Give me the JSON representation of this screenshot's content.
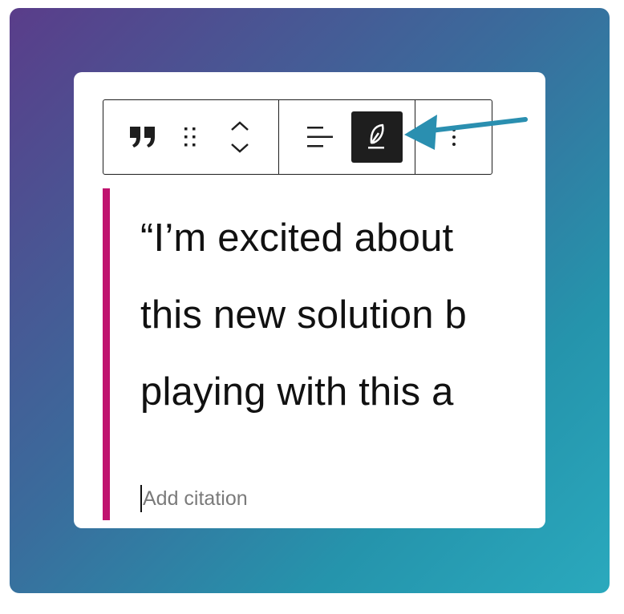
{
  "toolbar": {
    "buttons": [
      {
        "name": "quote-icon",
        "label": "Quote"
      },
      {
        "name": "drag-handle-icon",
        "label": "Drag"
      },
      {
        "name": "mover-icon",
        "label": "Move up / Move down"
      },
      {
        "name": "align-left-icon",
        "label": "Align text"
      },
      {
        "name": "feather-icon",
        "label": "Styles",
        "active": true
      },
      {
        "name": "more-vertical-icon",
        "label": "Options"
      }
    ]
  },
  "quote": {
    "lines": [
      "“I’m excited about",
      "this new solution b",
      "playing with this a"
    ],
    "citation_placeholder": "Add citation"
  },
  "colors": {
    "accent_border": "#c0136f",
    "active_button": "#1e1e1e",
    "arrow": "#2a8fb0",
    "gradient_start": "#5a3d8a",
    "gradient_end": "#2aa9bd"
  }
}
